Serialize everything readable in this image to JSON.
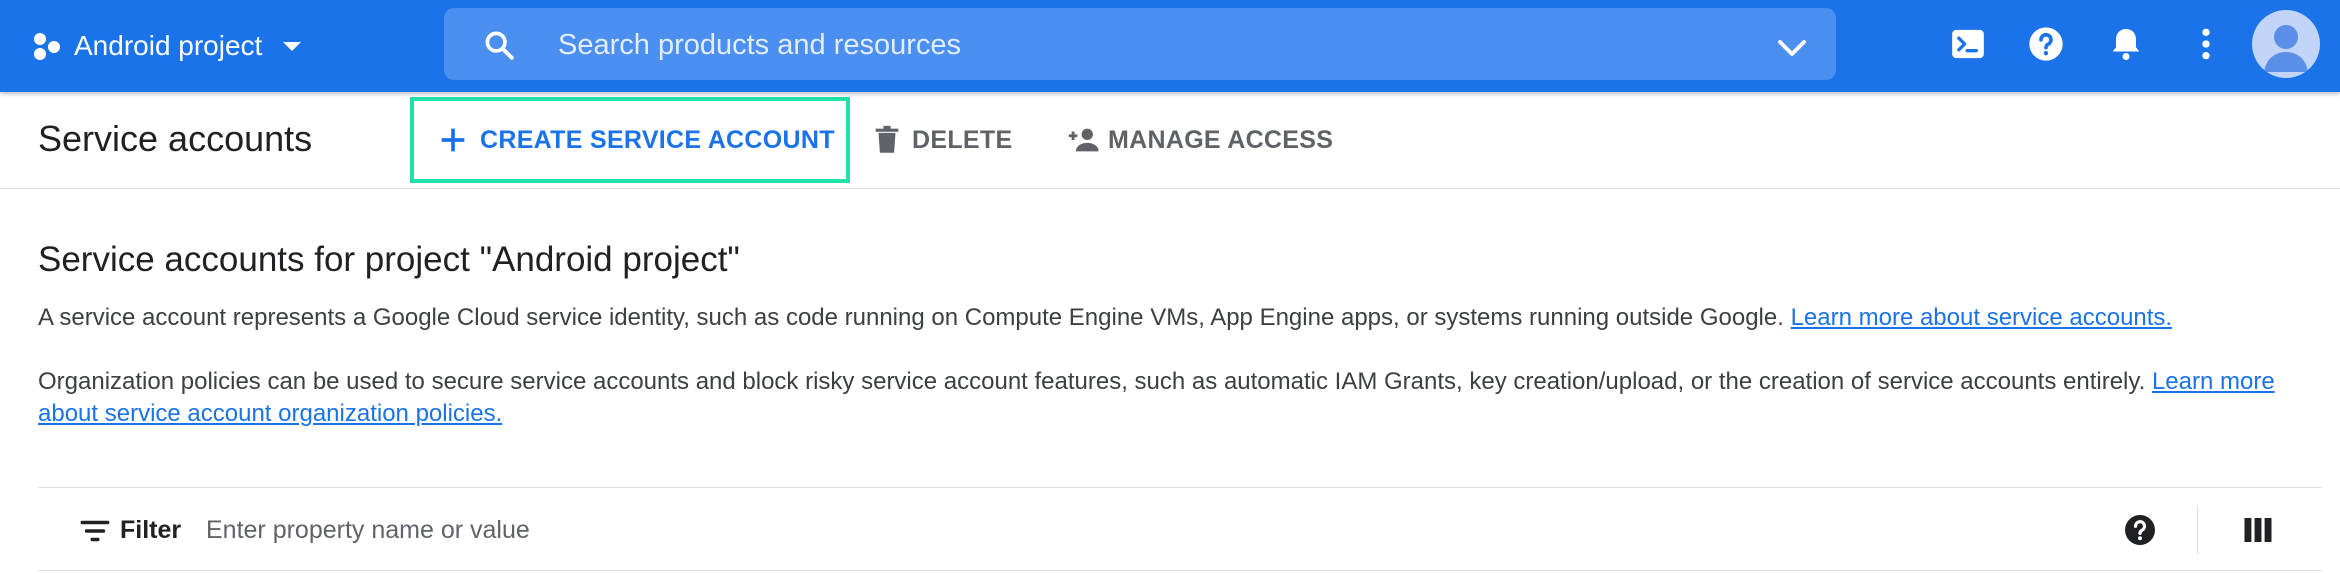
{
  "topbar": {
    "project_name": "Android project",
    "search_placeholder": "Search products and resources",
    "icons": [
      "cloud-shell-icon",
      "help-icon",
      "notifications-icon",
      "more-vert-icon",
      "avatar"
    ],
    "background_color": "#1a73e8"
  },
  "actionbar": {
    "title": "Service accounts",
    "create_label": "CREATE SERVICE ACCOUNT",
    "delete_label": "DELETE",
    "manage_label": "MANAGE ACCESS",
    "highlight_color": "#1ee3a8"
  },
  "content": {
    "heading": "Service accounts for project \"Android project\"",
    "para1_text": "A service account represents a Google Cloud service identity, such as code running on Compute Engine VMs, App Engine apps, or systems running outside Google. ",
    "para1_link": "Learn more about service accounts.",
    "para2_text": "Organization policies can be used to secure service accounts and block risky service account features, such as automatic IAM Grants, key creation/upload, or the creation of service accounts entirely. ",
    "para2_link": "Learn more about service account organization policies."
  },
  "filter": {
    "label": "Filter",
    "placeholder": "Enter property name or value"
  }
}
